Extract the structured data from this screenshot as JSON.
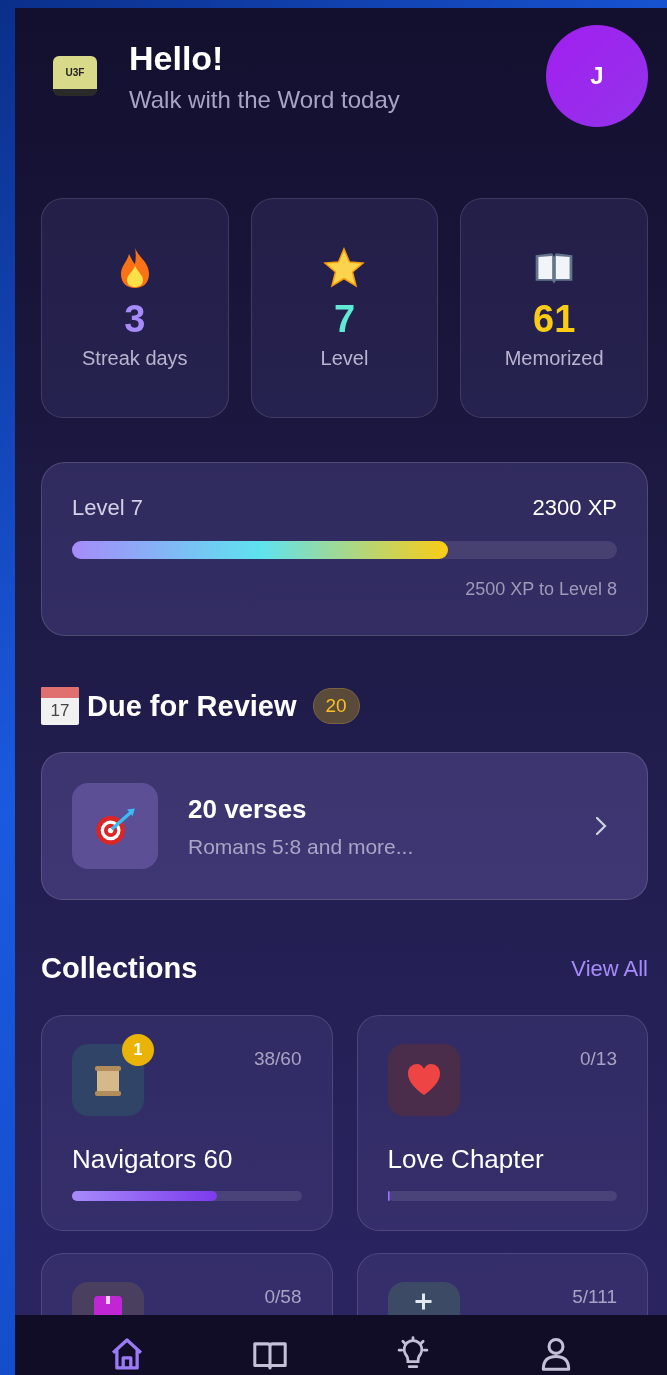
{
  "header": {
    "logo_text": "U3F",
    "title": "Hello!",
    "subtitle": "Walk with the Word today",
    "avatar": "J"
  },
  "stats": [
    {
      "kind": "flame",
      "value": "3",
      "label": "Streak days",
      "color": "#a78bfa"
    },
    {
      "kind": "star",
      "value": "7",
      "label": "Level",
      "color": "#5eead4"
    },
    {
      "kind": "book",
      "value": "61",
      "label": "Memorized",
      "color": "#facc15"
    }
  ],
  "xp": {
    "label": "Level 7",
    "amount": "2300 XP",
    "level": 0.69,
    "remaining": "2500 XP to Level 8"
  },
  "review": {
    "calendar_day": "17",
    "title": "Due for Review",
    "count": "20",
    "card_title": "20 verses",
    "card_subtitle": "Romans 5:8 and more..."
  },
  "collections": {
    "title": "Collections",
    "link": "View All",
    "items": [
      {
        "kind": "scroll",
        "count": "38/60",
        "badge": "1",
        "name": "Navigators 60",
        "level": 0.63
      },
      {
        "kind": "heart",
        "count": "0/13",
        "name": "Love Chapter",
        "level": 0
      },
      {
        "kind": "box",
        "count": "0/58"
      },
      {
        "kind": "plus",
        "count": "5/111"
      }
    ]
  },
  "nav": [
    {
      "kind": "home",
      "selected": true
    },
    {
      "kind": "book",
      "selected": false
    },
    {
      "kind": "bulb",
      "selected": false
    },
    {
      "kind": "person",
      "selected": false
    }
  ]
}
